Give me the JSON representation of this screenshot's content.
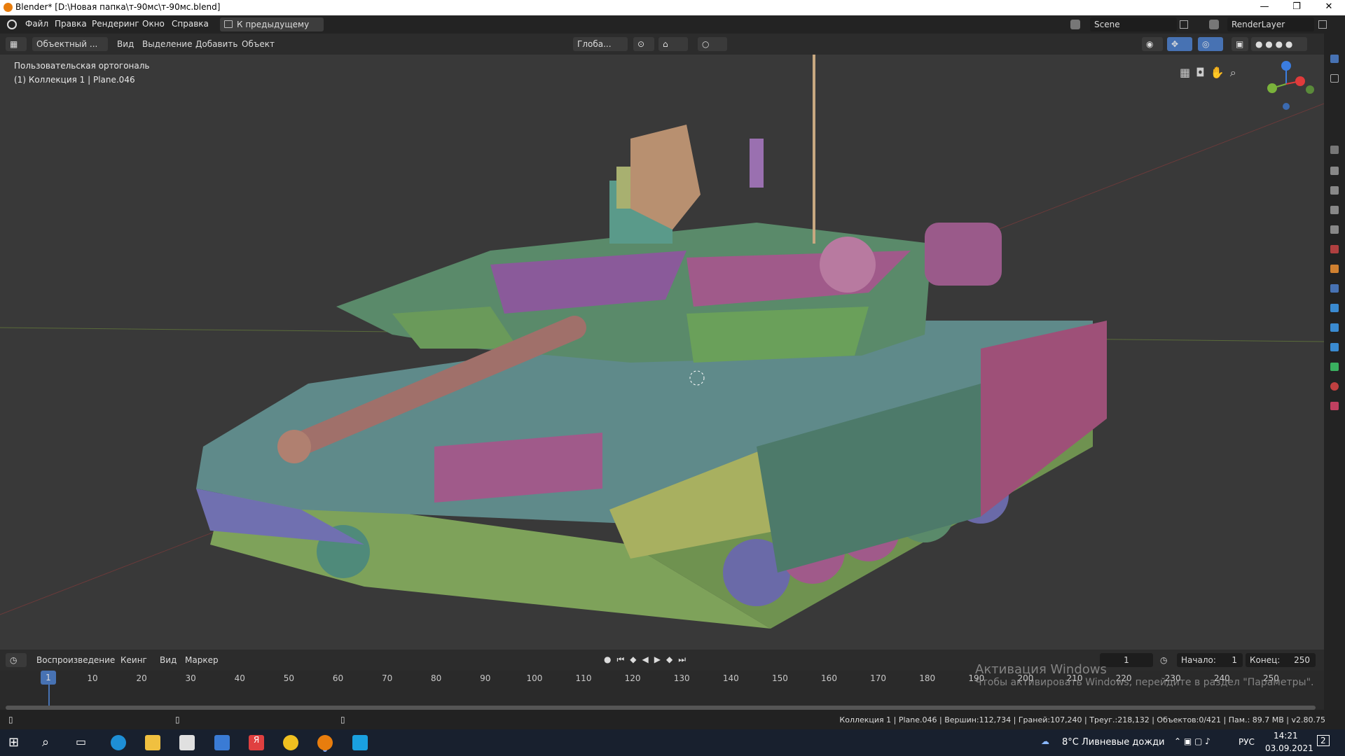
{
  "window": {
    "title": "Blender* [D:\\Новая папка\\т-90мс\\т-90мс.blend]",
    "min": "—",
    "max": "❐",
    "close": "✕"
  },
  "menu": {
    "file": "Файл",
    "edit": "Правка",
    "render": "Рендеринг",
    "window": "Окно",
    "help": "Справка",
    "back_button": "К предыдущему виду"
  },
  "scene": {
    "name": "Scene",
    "render_layer": "RenderLayer"
  },
  "viewport_header": {
    "mode": "Объектный ...",
    "view": "Вид",
    "select": "Выделение",
    "add": "Добавить",
    "object": "Объект",
    "transform": "Глоба..."
  },
  "viewport": {
    "projection": "Пользовательская ортогональ",
    "collection": "(1) Коллекция 1 | Plane.046"
  },
  "timeline": {
    "playback": "Воспроизведение",
    "keying": "Кеинг",
    "view": "Вид",
    "marker": "Маркер",
    "current_frame": "1",
    "start_label": "Начало:",
    "start": "1",
    "end_label": "Конец:",
    "end": "250",
    "ticks": [
      "10",
      "20",
      "30",
      "40",
      "50",
      "60",
      "70",
      "80",
      "90",
      "100",
      "110",
      "120",
      "130",
      "140",
      "150",
      "160",
      "170",
      "180",
      "190",
      "200",
      "210",
      "220",
      "230",
      "240",
      "250"
    ],
    "cursor_frame": "1"
  },
  "watermark": {
    "line1": "Активация Windows",
    "line2": "Чтобы активировать Windows, перейдите в раздел \"Параметры\"."
  },
  "status": "Коллекция 1 | Plane.046 | Вершин:112,734 | Граней:107,240 | Треуг.:218,132 | Объектов:0/421 | Пам.: 89.7 MB | v2.80.75",
  "taskbar": {
    "weather": "8°C  Ливневые дожди",
    "lang": "РУС",
    "time": "14:21",
    "date": "03.09.2021",
    "notif": "2"
  },
  "colors": {
    "accent": "#4772b3",
    "blender_orange": "#e87d0d"
  }
}
